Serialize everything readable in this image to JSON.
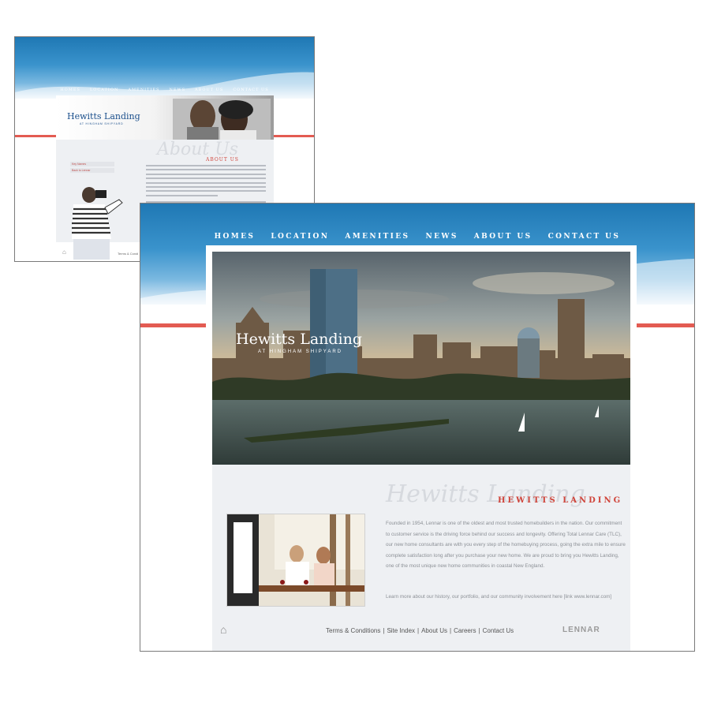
{
  "nav": {
    "items": [
      "Homes",
      "Location",
      "Amenities",
      "News",
      "About Us",
      "Contact Us"
    ]
  },
  "brand": {
    "logo": "Hewitts Landing",
    "logo_sub": "AT HINGHAM SHIPYARD",
    "lennar": "LENNAR"
  },
  "back_page": {
    "watermark": "About Us",
    "heading": "ABOUT US",
    "side_menu": [
      "Key Names",
      "Back to Lennar"
    ],
    "footer_text": "Terms & Condi"
  },
  "front_page": {
    "watermark": "Hewitts Landing",
    "heading": "HEWITTS LANDING",
    "paragraph": "Founded in 1954, Lennar is one of the oldest and most trusted homebuilders in the nation. Our commitment to customer service is the driving force behind our success and longevity. Offering Total Lennar Care (TLC), our new home consultants are with you every step of the homebuying process, going the extra mile to ensure complete satisfaction long after you purchase your new home. We are proud to bring you Hewitts Landing, one of the most unique new home communities in coastal New England.",
    "learn_more": "Learn more about our history, our portfolio, and our community involvement here [link www.lennar.com]",
    "footer_links": [
      "Terms & Conditions",
      "Site Index",
      "About Us",
      "Careers",
      "Contact Us"
    ]
  },
  "colors": {
    "band_blue": "#1f78b4",
    "accent_red": "#e35b52",
    "heading_red": "#d0443a",
    "logo_blue": "#1b4f8c"
  }
}
